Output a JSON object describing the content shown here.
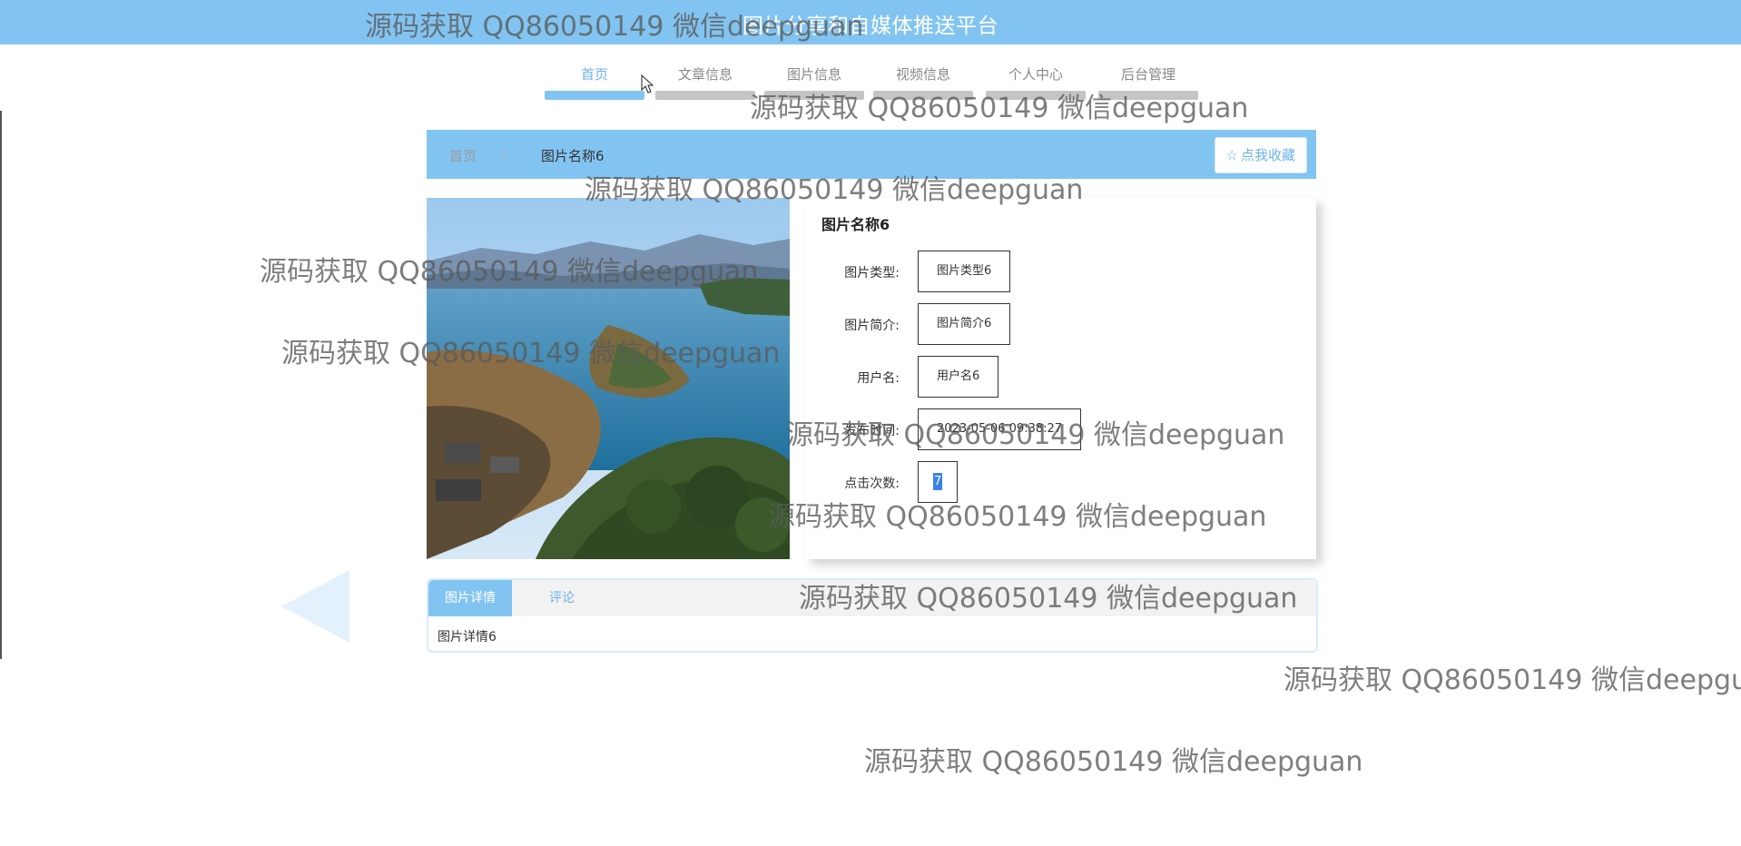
{
  "header": {
    "title": "图片分享和自媒体推送平台"
  },
  "nav": {
    "items": [
      {
        "label": "首页",
        "active": true
      },
      {
        "label": "文章信息",
        "active": false
      },
      {
        "label": "图片信息",
        "active": false
      },
      {
        "label": "视频信息",
        "active": false
      },
      {
        "label": "个人中心",
        "active": false
      },
      {
        "label": "后台管理",
        "active": false
      }
    ]
  },
  "breadcrumb": {
    "home": "首页",
    "separator": "/",
    "current": "图片名称6"
  },
  "favorite_button": {
    "icon": "star-outline-icon",
    "label": "点我收藏"
  },
  "detail": {
    "title": "图片名称6",
    "fields": [
      {
        "label": "图片类型:",
        "value": "图片类型6"
      },
      {
        "label": "图片简介:",
        "value": "图片简介6"
      },
      {
        "label": "用户名:",
        "value": "用户名6"
      },
      {
        "label": "发布时间:",
        "value": "2023-05-06 09:38:27"
      },
      {
        "label": "点击次数:",
        "value": "7"
      }
    ]
  },
  "tabs": {
    "items": [
      {
        "label": "图片详情",
        "active": true
      },
      {
        "label": "评论",
        "active": false
      }
    ],
    "content": "图片详情6"
  },
  "watermark": {
    "text": "源码获取 QQ86050149 微信deepguan"
  },
  "colors": {
    "primary": "#82c4f1",
    "accent_text": "#6cb2e8"
  }
}
